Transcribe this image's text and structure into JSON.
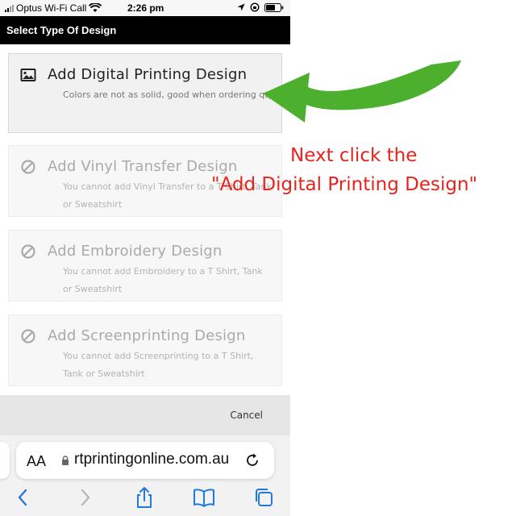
{
  "status_bar": {
    "carrier": "Optus Wi-Fi Call",
    "time": "2:26 pm"
  },
  "dialog": {
    "title": "Select Type Of Design",
    "options": [
      {
        "title": "Add Digital Printing Design",
        "description": "Colors are not as solid, good when ordering qty",
        "icon": "image-icon",
        "enabled": true
      },
      {
        "title": "Add Vinyl Transfer Design",
        "description": "You cannot add Vinyl Transfer to a T Shirt, Tank or Sweatshirt",
        "icon": "prohibited-icon",
        "enabled": false
      },
      {
        "title": "Add Embroidery Design",
        "description": "You cannot add Embroidery to a T Shirt, Tank or Sweatshirt",
        "icon": "prohibited-icon",
        "enabled": false
      },
      {
        "title": "Add Screenprinting Design",
        "description": "You cannot add Screenprinting to a T Shirt, Tank or Sweatshirt",
        "icon": "prohibited-icon",
        "enabled": false
      }
    ],
    "cancel_label": "Cancel"
  },
  "browser": {
    "text_size_label": "AA",
    "url": "rtprintingonline.com.au"
  },
  "annotation": {
    "line1": "Next click the",
    "line2": "\"Add Digital Printing Design\"",
    "color": "#e8231c",
    "arrow_color": "#4caf2e"
  }
}
